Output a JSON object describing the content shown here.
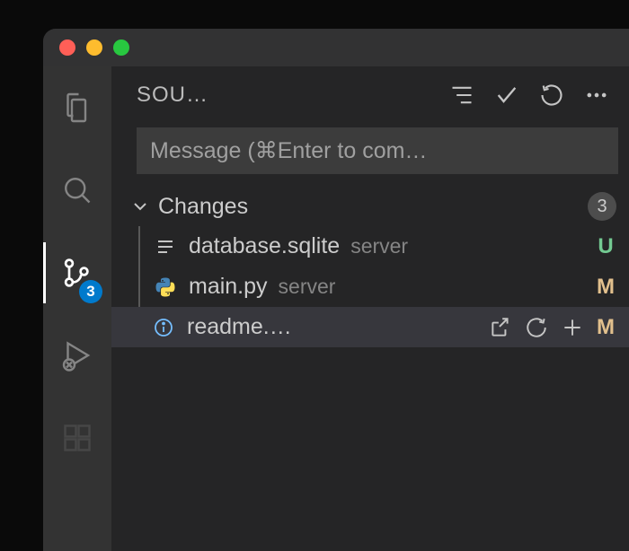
{
  "panel": {
    "title": "SOU…"
  },
  "commit": {
    "placeholder": "Message (⌘Enter to com…"
  },
  "changes": {
    "label": "Changes",
    "count": "3"
  },
  "scm_badge": "3",
  "files": [
    {
      "name": "database.sqlite",
      "path": "server",
      "status": "U"
    },
    {
      "name": "main.py",
      "path": "server",
      "status": "M"
    },
    {
      "name": "readme.…",
      "path": "",
      "status": "M"
    }
  ]
}
